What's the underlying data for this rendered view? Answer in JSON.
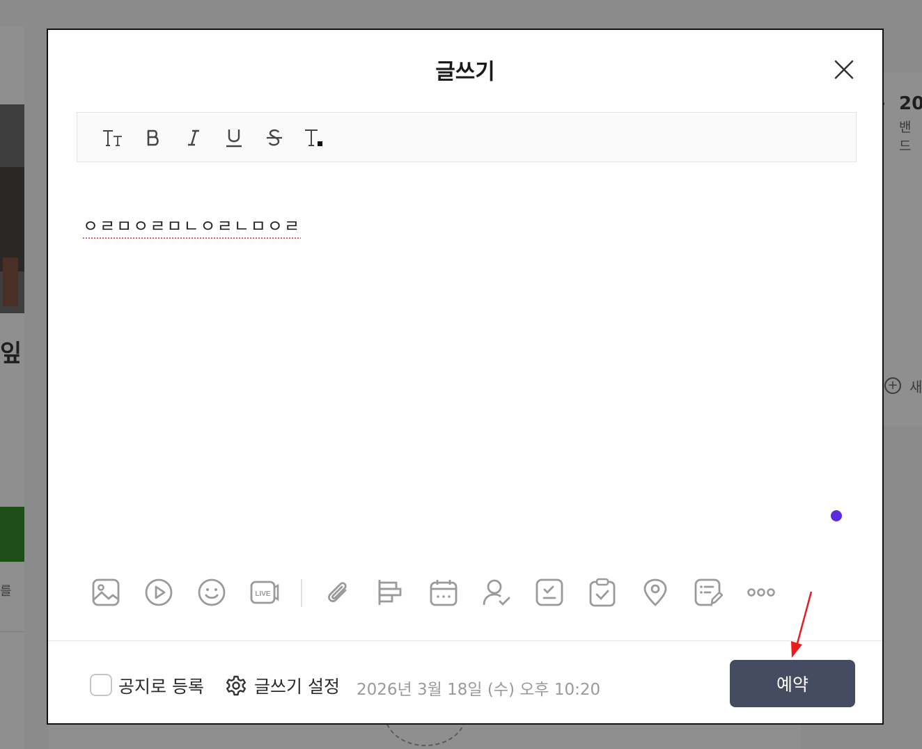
{
  "modal": {
    "title": "글쓰기"
  },
  "toolbar": {
    "buttons": [
      {
        "name": "font-size",
        "glyph": "TT"
      },
      {
        "name": "bold",
        "glyph": "B"
      },
      {
        "name": "italic",
        "glyph": "I"
      },
      {
        "name": "underline",
        "glyph": "U"
      },
      {
        "name": "strikethrough",
        "glyph": "S"
      },
      {
        "name": "text-color",
        "glyph": "T"
      }
    ]
  },
  "editor": {
    "content": "ㅇㄹㅁㅇㄹㅁㄴㅇㄹㄴㅁㅇㄹ"
  },
  "attachments": {
    "icons": [
      "image-icon",
      "video-icon",
      "emoji-icon",
      "live-icon",
      "paperclip-icon",
      "chart-icon",
      "calendar-icon",
      "mention-icon",
      "vote-icon",
      "todo-icon",
      "location-icon",
      "quiz-icon",
      "more-icon"
    ],
    "live_label": "LIVE"
  },
  "footer": {
    "notice_label": "공지로 등록",
    "settings_label": "글쓰기 설정",
    "schedule_date": "2026년 3월 18일 (수) 오후 10:20",
    "reserve_label": "예약"
  },
  "background": {
    "left_title_fragment": "잎",
    "left_small_fragment": "를",
    "right_number_fragment": "20",
    "right_sub_fragment": "밴드",
    "right_plus_label_fragment": "새"
  },
  "colors": {
    "primary_button": "#454b60",
    "accent_dot": "#5b2be0",
    "annotation_arrow": "#e81c1c"
  }
}
